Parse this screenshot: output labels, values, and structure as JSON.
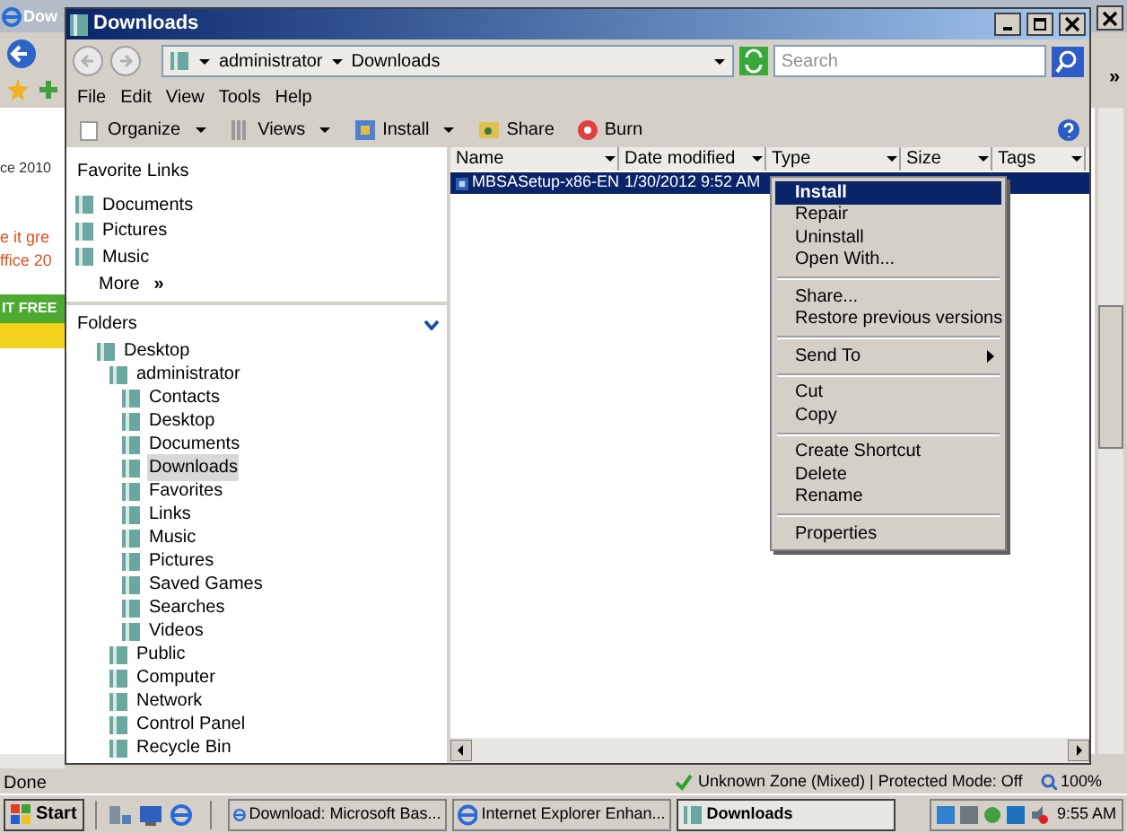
{
  "background_window": {
    "title": "Dow",
    "page_texts": [
      "ce 2010",
      "e it gre",
      "ffice 20"
    ],
    "banner": "IT FREE",
    "more": "»",
    "status": "Done",
    "zone": "Unknown Zone (Mixed) | Protected Mode: Off",
    "zoom": "100%"
  },
  "window": {
    "title": "Downloads"
  },
  "address": {
    "crumbs": [
      "administrator",
      "Downloads"
    ]
  },
  "search": {
    "placeholder": "Search"
  },
  "menu_bar": [
    "File",
    "Edit",
    "View",
    "Tools",
    "Help"
  ],
  "toolbar": [
    {
      "label": "Organize",
      "dropdown": true
    },
    {
      "label": "Views",
      "dropdown": true
    },
    {
      "label": "Install",
      "dropdown": true
    },
    {
      "label": "Share",
      "dropdown": false
    },
    {
      "label": "Burn",
      "dropdown": false
    }
  ],
  "favorite_links": {
    "title": "Favorite Links",
    "items": [
      "Documents",
      "Pictures",
      "Music"
    ],
    "more": "More",
    "more_icon": "»"
  },
  "folders": {
    "title": "Folders",
    "tree": [
      {
        "label": "Desktop",
        "selected": false,
        "children": [
          {
            "label": "administrator",
            "selected": false,
            "children": [
              {
                "label": "Contacts",
                "selected": false
              },
              {
                "label": "Desktop",
                "selected": false
              },
              {
                "label": "Documents",
                "selected": false
              },
              {
                "label": "Downloads",
                "selected": true
              },
              {
                "label": "Favorites",
                "selected": false
              },
              {
                "label": "Links",
                "selected": false
              },
              {
                "label": "Music",
                "selected": false
              },
              {
                "label": "Pictures",
                "selected": false
              },
              {
                "label": "Saved Games",
                "selected": false
              },
              {
                "label": "Searches",
                "selected": false
              },
              {
                "label": "Videos",
                "selected": false
              }
            ]
          },
          {
            "label": "Public",
            "selected": false
          },
          {
            "label": "Computer",
            "selected": false
          },
          {
            "label": "Network",
            "selected": false
          },
          {
            "label": "Control Panel",
            "selected": false
          },
          {
            "label": "Recycle Bin",
            "selected": false
          }
        ]
      }
    ]
  },
  "columns": [
    "Name",
    "Date modified",
    "Type",
    "Size",
    "Tags"
  ],
  "files": [
    {
      "name": "MBSASetup-x86-EN",
      "date": "1/30/2012 9:52 AM",
      "selected": true
    }
  ],
  "context_menu": [
    [
      {
        "label": "Install",
        "kind": "command",
        "default": true,
        "selected": true
      },
      {
        "label": "Repair",
        "kind": "command",
        "default": false,
        "selected": false
      },
      {
        "label": "Uninstall",
        "kind": "command",
        "default": false,
        "selected": false
      },
      {
        "label": "Open With...",
        "kind": "command",
        "default": false,
        "selected": false
      }
    ],
    [
      {
        "label": "Share...",
        "kind": "command",
        "default": false,
        "selected": false
      },
      {
        "label": "Restore previous versions",
        "kind": "command",
        "default": false,
        "selected": false
      }
    ],
    [
      {
        "label": "Send To",
        "kind": "submenu",
        "default": false,
        "selected": false
      }
    ],
    [
      {
        "label": "Cut",
        "kind": "command",
        "default": false,
        "selected": false
      },
      {
        "label": "Copy",
        "kind": "command",
        "default": false,
        "selected": false
      }
    ],
    [
      {
        "label": "Create Shortcut",
        "kind": "command",
        "default": false,
        "selected": false
      },
      {
        "label": "Delete",
        "kind": "command",
        "default": false,
        "selected": false
      },
      {
        "label": "Rename",
        "kind": "command",
        "default": false,
        "selected": false
      }
    ],
    [
      {
        "label": "Properties",
        "kind": "command",
        "default": false,
        "selected": false
      }
    ]
  ],
  "taskbar": {
    "start": "Start",
    "tasks": [
      {
        "label": "Download: Microsoft Bas...",
        "selected": false
      },
      {
        "label": "Internet Explorer Enhan...",
        "selected": false
      },
      {
        "label": "Downloads",
        "selected": true
      }
    ],
    "clock": "9:55 AM"
  }
}
